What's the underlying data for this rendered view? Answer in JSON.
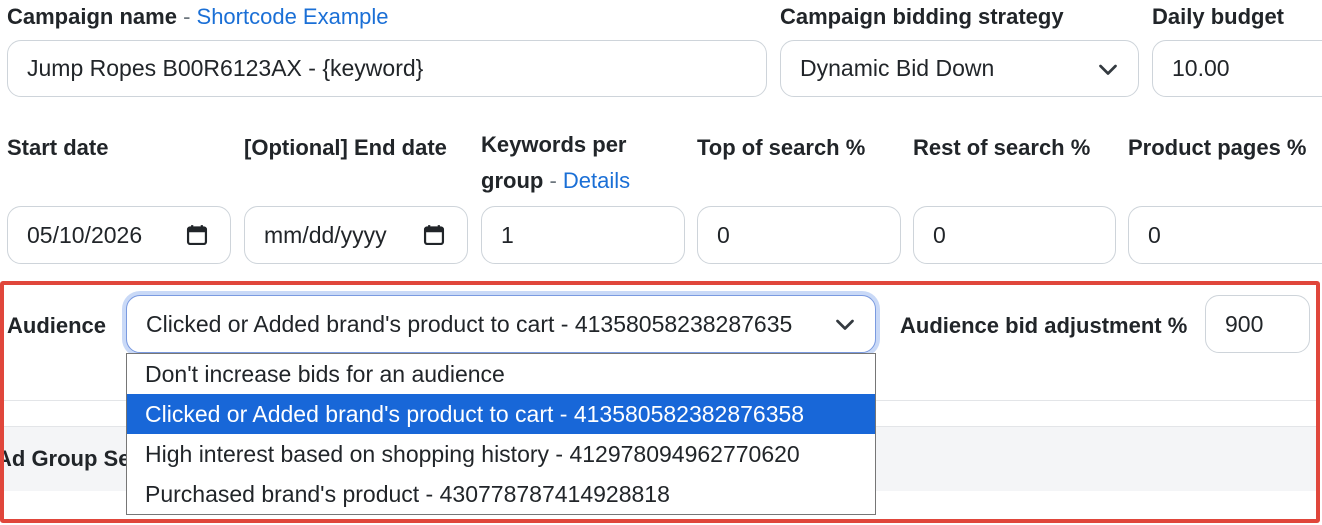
{
  "campaign": {
    "name_label": "Campaign name",
    "name_separator": "-",
    "shortcode_link": "Shortcode Example",
    "name_value": "Jump Ropes B00R6123AX - {keyword}",
    "bidding_label": "Campaign bidding strategy",
    "bidding_value": "Dynamic Bid Down",
    "budget_label": "Daily budget",
    "budget_value": "10.00"
  },
  "schedule": {
    "start_label": "Start date",
    "start_value": "05/10/2026",
    "end_label": "[Optional] End date",
    "end_placeholder": "mm/dd/yyyy",
    "kpg_label_line1": "Keywords per",
    "kpg_label_line2": "group",
    "kpg_separator": "-",
    "kpg_details_link": "Details",
    "kpg_value": "1",
    "top_label": "Top of search %",
    "top_value": "0",
    "rest_label": "Rest of search %",
    "rest_value": "0",
    "product_label": "Product pages %",
    "product_value": "0"
  },
  "audience": {
    "label": "Audience",
    "selected_value": "Clicked or Added brand's product to cart - 41358058238287635",
    "bid_adj_label": "Audience bid adjustment %",
    "bid_adj_value": "900",
    "options": [
      {
        "label": "Don't increase bids for an audience",
        "selected": false
      },
      {
        "label": "Clicked or Added brand's product to cart - 413580582382876358",
        "selected": true
      },
      {
        "label": "High interest based on shopping history - 412978094962770620",
        "selected": false
      },
      {
        "label": "Purchased brand's product - 430778787414928818",
        "selected": false
      }
    ]
  },
  "section": {
    "ad_group_heading_partial": "Ad Group Se"
  },
  "colors": {
    "accent_link": "#1a6fd6",
    "highlight_border": "#e0463b",
    "option_selected_bg": "#1867d8"
  },
  "icons": {
    "select_arrow": "chevron-down-icon",
    "date_picker": "calendar-icon"
  }
}
